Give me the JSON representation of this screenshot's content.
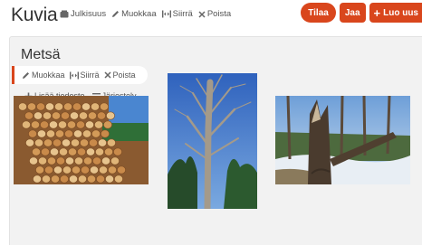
{
  "header": {
    "title": "Kuvia",
    "actions": {
      "publish": "Julkisuus",
      "edit": "Muokkaa",
      "move": "Siirrä",
      "delete": "Poista"
    },
    "buttons": {
      "order": "Tilaa",
      "share": "Jaa",
      "create": "Luo uus"
    }
  },
  "album": {
    "title": "Metsä",
    "toolbar": {
      "edit": "Muokkaa",
      "move": "Siirrä",
      "delete": "Poista"
    },
    "sub_actions": {
      "add_file": "Lisää tiedosto",
      "arrange": "Järjestely"
    },
    "photos": [
      {
        "subject": "stacked-logs"
      },
      {
        "subject": "dead-pine-tree"
      },
      {
        "subject": "broken-tree-snow"
      }
    ]
  },
  "colors": {
    "accent": "#d9461c",
    "panel": "#f2f2f2"
  }
}
